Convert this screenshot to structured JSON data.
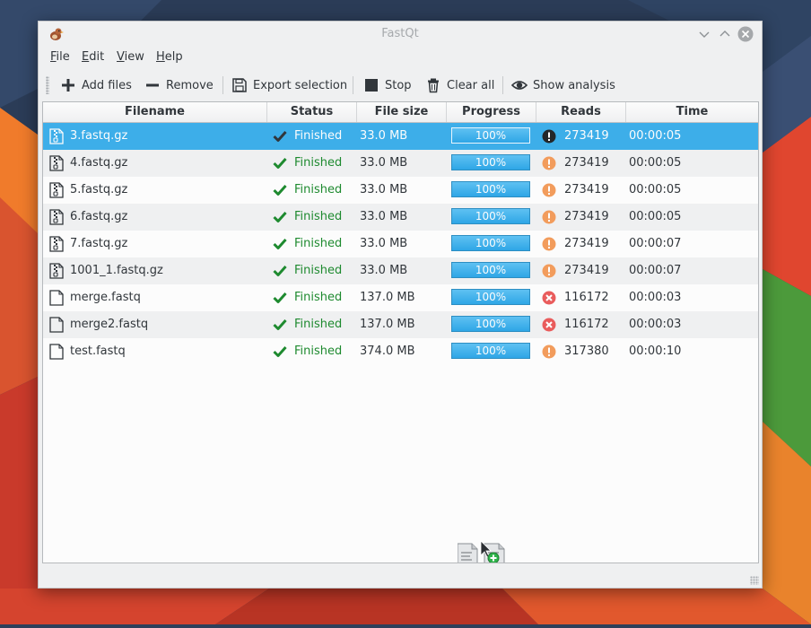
{
  "window": {
    "title": "FastQt"
  },
  "menu": [
    {
      "underline": "F",
      "rest": "ile"
    },
    {
      "underline": "E",
      "rest": "dit"
    },
    {
      "underline": "V",
      "rest": "iew"
    },
    {
      "underline": "H",
      "rest": "elp"
    }
  ],
  "toolbar": {
    "add_files": "Add files",
    "remove": "Remove",
    "export_selection": "Export selection",
    "stop": "Stop",
    "clear_all": "Clear all",
    "show_analysis": "Show analysis"
  },
  "columns": {
    "filename": "Filename",
    "status": "Status",
    "file_size": "File size",
    "progress": "Progress",
    "reads": "Reads",
    "time": "Time"
  },
  "rows": [
    {
      "filename": "3.fastq.gz",
      "status": "Finished",
      "size": "33.0 MB",
      "progress": "100%",
      "reads": "273419",
      "time": "00:00:05",
      "compressed": true,
      "alert": "warning"
    },
    {
      "filename": "4.fastq.gz",
      "status": "Finished",
      "size": "33.0 MB",
      "progress": "100%",
      "reads": "273419",
      "time": "00:00:05",
      "compressed": true,
      "alert": "warning"
    },
    {
      "filename": "5.fastq.gz",
      "status": "Finished",
      "size": "33.0 MB",
      "progress": "100%",
      "reads": "273419",
      "time": "00:00:05",
      "compressed": true,
      "alert": "warning"
    },
    {
      "filename": "6.fastq.gz",
      "status": "Finished",
      "size": "33.0 MB",
      "progress": "100%",
      "reads": "273419",
      "time": "00:00:05",
      "compressed": true,
      "alert": "warning"
    },
    {
      "filename": "7.fastq.gz",
      "status": "Finished",
      "size": "33.0 MB",
      "progress": "100%",
      "reads": "273419",
      "time": "00:00:07",
      "compressed": true,
      "alert": "warning"
    },
    {
      "filename": "1001_1.fastq.gz",
      "status": "Finished",
      "size": "33.0 MB",
      "progress": "100%",
      "reads": "273419",
      "time": "00:00:07",
      "compressed": true,
      "alert": "warning"
    },
    {
      "filename": "merge.fastq",
      "status": "Finished",
      "size": "137.0 MB",
      "progress": "100%",
      "reads": "116172",
      "time": "00:00:03",
      "compressed": false,
      "alert": "error"
    },
    {
      "filename": "merge2.fastq",
      "status": "Finished",
      "size": "137.0 MB",
      "progress": "100%",
      "reads": "116172",
      "time": "00:00:03",
      "compressed": false,
      "alert": "error"
    },
    {
      "filename": "test.fastq",
      "status": "Finished",
      "size": "374.0 MB",
      "progress": "100%",
      "reads": "317380",
      "time": "00:00:10",
      "compressed": false,
      "alert": "warning"
    }
  ],
  "selected_row": 0,
  "colors": {
    "selection": "#3daee9",
    "finished": "#1e8a2f",
    "warning": "#f29c5c",
    "error": "#e95c5c"
  },
  "icons": [
    "app-bird-icon",
    "add-icon",
    "remove-icon",
    "save-icon",
    "stop-icon",
    "trash-icon",
    "eye-icon",
    "archive-file-icon",
    "text-file-icon",
    "check-icon",
    "warning-icon",
    "error-icon",
    "drag-copy-icon"
  ]
}
